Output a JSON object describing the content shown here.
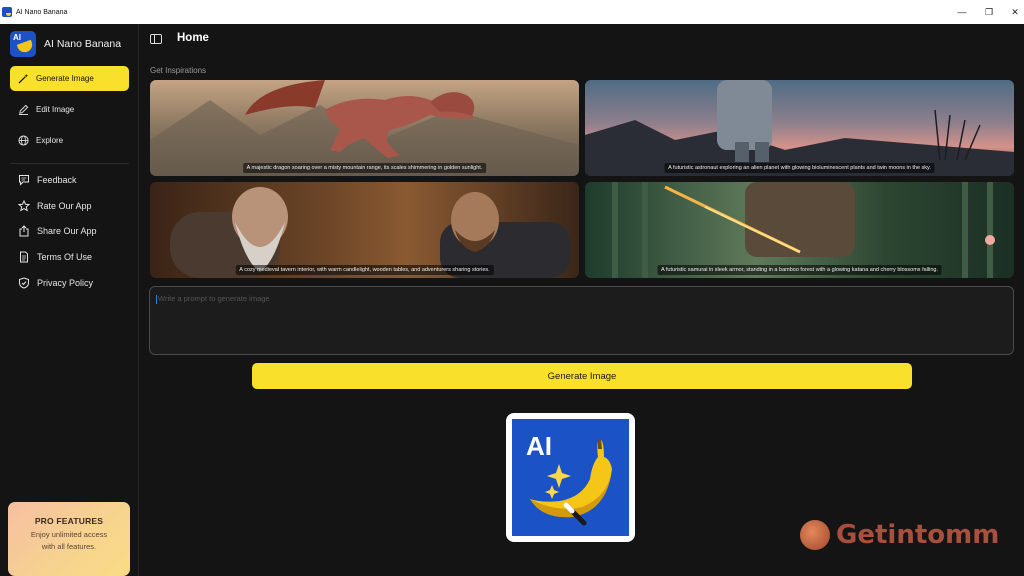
{
  "window": {
    "title": "AI Nano Banana",
    "minimize_glyph": "—",
    "maximize_glyph": "❐",
    "close_glyph": "✕"
  },
  "brand": {
    "name": "AI Nano Banana",
    "logo_text": "AI",
    "logo_icon": "banana-icon"
  },
  "nav": {
    "items": [
      {
        "label": "Generate Image",
        "icon": "magic-wand-icon",
        "active": true
      },
      {
        "label": "Edit Image",
        "icon": "pencil-icon",
        "active": false
      },
      {
        "label": "Explore",
        "icon": "globe-icon",
        "active": false
      }
    ],
    "secondary": [
      {
        "label": "Feedback",
        "icon": "chat-icon"
      },
      {
        "label": "Rate Our App",
        "icon": "star-icon"
      },
      {
        "label": "Share Our App",
        "icon": "share-icon"
      },
      {
        "label": "Terms Of Use",
        "icon": "document-icon"
      },
      {
        "label": "Privacy Policy",
        "icon": "shield-icon"
      }
    ]
  },
  "pro": {
    "title": "PRO FEATURES",
    "description": "Enjoy unlimited access with all features."
  },
  "header": {
    "title": "Home",
    "toggle_icon": "sidebar-toggle-icon"
  },
  "inspirations": {
    "label": "Get Inspirations",
    "cards": [
      {
        "caption": "A majestic dragon soaring over a misty mountain range, its scales shimmering in golden sunlight."
      },
      {
        "caption": "A futuristic astronaut exploring an alien planet with glowing bioluminescent plants and twin moons in the sky."
      },
      {
        "caption": "A cozy medieval tavern interior, with warm candlelight, wooden tables, and adventurers sharing stories."
      },
      {
        "caption": "A futuristic samurai in sleek armor, standing in a bamboo forest with a glowing katana and cherry blossoms falling."
      }
    ]
  },
  "prompt": {
    "placeholder": "Write a prompt to generate image"
  },
  "generate_button": {
    "label": "Generate Image"
  },
  "preview": {
    "logo_text": "AI",
    "icon": "banana-icon"
  },
  "watermark": {
    "text": "Getintomm"
  },
  "colors": {
    "accent": "#f9e12b",
    "background": "#141414",
    "brand_blue": "#1b53c6"
  }
}
